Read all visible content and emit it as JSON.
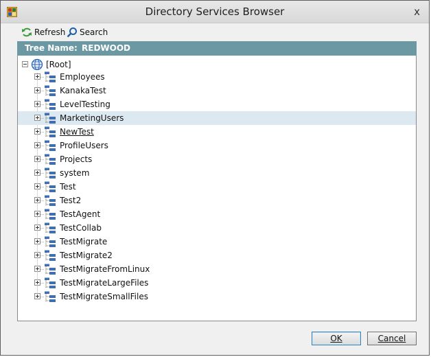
{
  "window": {
    "title": "Directory Services Browser",
    "close_glyph": "x",
    "app_icon": "app-icon",
    "close_icon": "close-icon"
  },
  "toolbar": {
    "refresh": {
      "label": "Refresh",
      "icon": "refresh-icon",
      "color": "#3a9d3a"
    },
    "search": {
      "label": "Search",
      "icon": "search-icon",
      "color": "#1f5fa8"
    }
  },
  "header": {
    "label": "Tree Name:",
    "value": "REDWOOD",
    "color": "#6c98a3"
  },
  "tree": {
    "root": {
      "label": "[Root]",
      "icon": "globe-icon",
      "expanded": true
    },
    "selected_color": "#dde9f0",
    "items": [
      {
        "label": "Employees",
        "selected": false,
        "underlined": false
      },
      {
        "label": "KanakaTest",
        "selected": false,
        "underlined": false
      },
      {
        "label": "LevelTesting",
        "selected": false,
        "underlined": false
      },
      {
        "label": "MarketingUsers",
        "selected": true,
        "underlined": false
      },
      {
        "label": "NewTest",
        "selected": false,
        "underlined": true
      },
      {
        "label": "ProfileUsers",
        "selected": false,
        "underlined": false
      },
      {
        "label": "Projects",
        "selected": false,
        "underlined": false
      },
      {
        "label": "system",
        "selected": false,
        "underlined": false
      },
      {
        "label": "Test",
        "selected": false,
        "underlined": false
      },
      {
        "label": "Test2",
        "selected": false,
        "underlined": false
      },
      {
        "label": "TestAgent",
        "selected": false,
        "underlined": false
      },
      {
        "label": "TestCollab",
        "selected": false,
        "underlined": false
      },
      {
        "label": "TestMigrate",
        "selected": false,
        "underlined": false
      },
      {
        "label": "TestMigrate2",
        "selected": false,
        "underlined": false
      },
      {
        "label": "TestMigrateFromLinux",
        "selected": false,
        "underlined": false
      },
      {
        "label": "TestMigrateLargeFiles",
        "selected": false,
        "underlined": false
      },
      {
        "label": "TestMigrateSmallFiles",
        "selected": false,
        "underlined": false
      }
    ],
    "item_icon": "container-tree-icon"
  },
  "buttons": {
    "ok": "OK",
    "cancel": "Cancel"
  }
}
